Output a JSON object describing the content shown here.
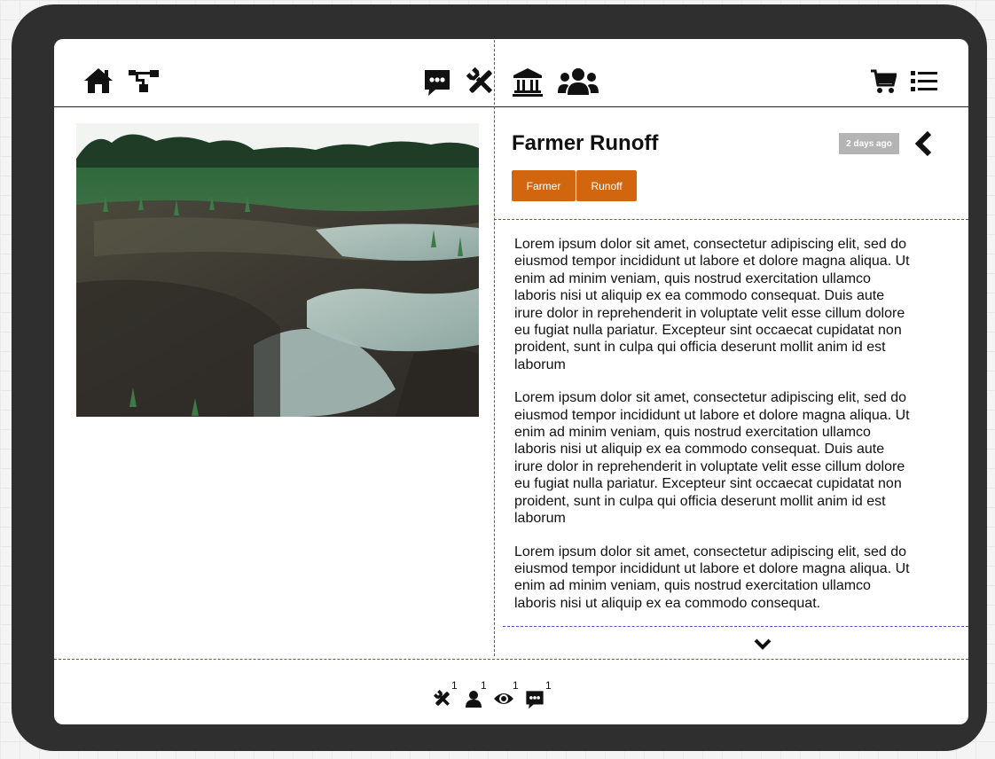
{
  "article": {
    "title": "Farmer Runoff",
    "time_label": "2 days ago",
    "tags": [
      "Farmer",
      "Runoff"
    ],
    "paragraphs": [
      "Lorem ipsum dolor sit amet, consectetur adipiscing elit, sed do eiusmod tempor incididunt ut labore et dolore magna aliqua. Ut enim ad minim veniam, quis nostrud exercitation ullamco laboris nisi ut aliquip ex ea commodo consequat. Duis aute irure dolor in reprehenderit in voluptate velit esse cillum dolore eu fugiat nulla pariatur. Excepteur sint occaecat cupidatat non proident, sunt in culpa qui officia deserunt mollit anim id est laborum",
      "Lorem ipsum dolor sit amet, consectetur adipiscing elit, sed do eiusmod tempor incididunt ut labore et dolore magna aliqua. Ut enim ad minim veniam, quis nostrud exercitation ullamco laboris nisi ut aliquip ex ea commodo consequat. Duis aute irure dolor in reprehenderit in voluptate velit esse cillum dolore eu fugiat nulla pariatur. Excepteur sint occaecat cupidatat non proident, sunt in culpa qui officia deserunt mollit anim id est laborum",
      "Lorem ipsum dolor sit amet, consectetur adipiscing elit, sed do eiusmod tempor incididunt ut labore et dolore magna aliqua. Ut enim ad minim veniam, quis nostrud exercitation ullamco laboris nisi ut aliquip ex ea commodo consequat."
    ]
  },
  "footer": {
    "counts": {
      "tools": "1",
      "user": "1",
      "views": "1",
      "comments": "1"
    }
  },
  "icons": {
    "nav_left": [
      "home-icon",
      "sitemap-icon"
    ],
    "nav_center": [
      "comment-dots-icon",
      "tools-icon",
      "university-icon",
      "users-icon"
    ],
    "nav_right": [
      "cart-icon",
      "list-icon"
    ],
    "article": [
      "back-chevron-icon",
      "expand-chevron-down-icon"
    ],
    "footer": [
      "tools-icon",
      "user-icon",
      "eye-icon",
      "comment-dots-icon"
    ]
  }
}
